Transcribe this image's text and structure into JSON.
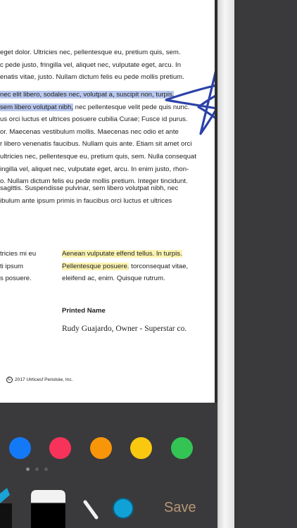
{
  "document": {
    "para1": [
      "eget dolor.   Ultricies nec, pellentesque eu, pretium quis, sem.",
      "c pede justo, fringilla vel, aliquet nec, vulputate eget, arcu. In",
      "enatis vitae, justo. Nullam dictum felis eu pede mollis pretium."
    ],
    "para2_hl1": "nec elit libero, sodales nec, volutpat a, suscipit non, turpis.",
    "para2_hl2": "sem libero volutpat nibh,",
    "para2_line2_rest": " nec pellentesque velit pede quis nunc.",
    "para2_rest": [
      "us orci luctus et ultrices posuere cubilia Curae; Fusce id purus.",
      "or. Maecenas vestibulum mollis. Maecenas nec odio et ante",
      "r libero venenatis faucibus. Nullam quis ante. Etiam sit amet orci",
      "ultricies nec, pellentesque eu, pretium quis, sem. Nulla consequat",
      "ingilla vel, aliquet nec, vulputate eget, arcu. In enim justo, rhon-",
      "o. Nullam dictum felis eu pede mollis pretium. Integer tincidunt."
    ],
    "para3": [
      "sagittis. Suspendisse pulvinar, sem libero volutpat nibh, nec",
      "ibulum ante ipsum primis in faucibus orci luctus et ultrices"
    ],
    "col_left": [
      "tricies mi eu",
      "ti ipsum",
      "s posuere."
    ],
    "col_right_hl1": "Aenean vulputate elfend tellus. In turpis.",
    "col_right_hl2": "Pellentesque posuere.",
    "col_right_line2_rest": " torconsequat vitae,",
    "col_right_line3": "eleifend ac, enim. Quisque rutrum.",
    "printed_name_label": "Printed Name",
    "signature": "Rudy Guajardo, Owner - Superstar co.",
    "copyright_symbol": "C",
    "copyright": "2017 Ulrticesf Periotoie, Inc."
  },
  "palette": {
    "colors": [
      {
        "name": "blue",
        "hex": "#1479f7"
      },
      {
        "name": "red",
        "hex": "#f8335a"
      },
      {
        "name": "orange",
        "hex": "#f99509"
      },
      {
        "name": "yellow",
        "hex": "#fbc810"
      },
      {
        "name": "green",
        "hex": "#34c454"
      }
    ],
    "page_count": 3,
    "active_page": 1
  },
  "tools": {
    "selected_color": "#10a2d6",
    "save_label": "Save"
  },
  "drawing": {
    "stroke_color": "#2b42a8"
  }
}
